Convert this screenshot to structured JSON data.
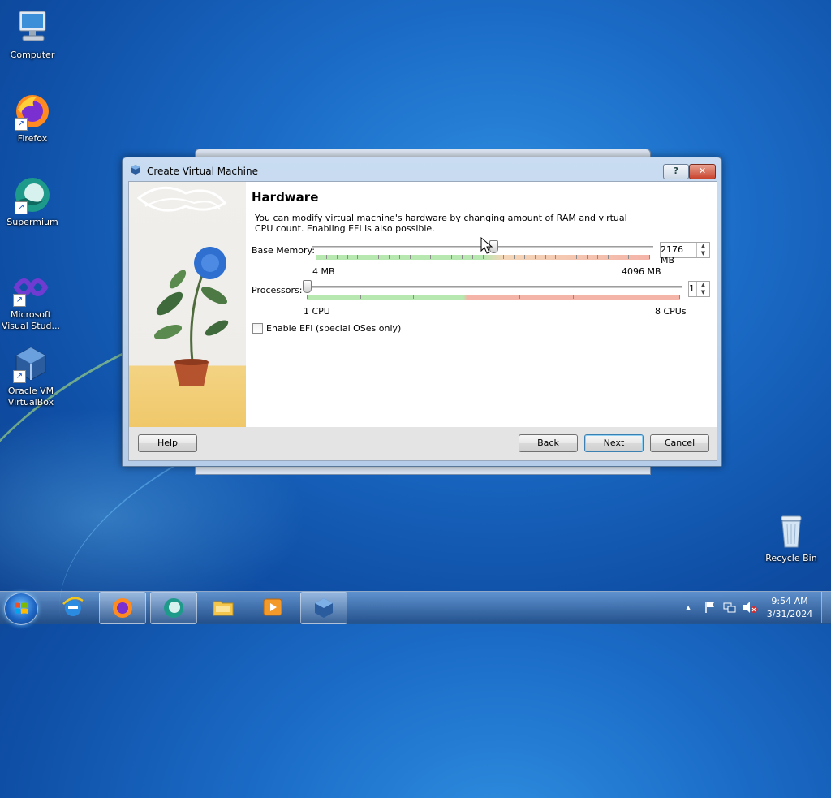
{
  "desktop": {
    "icons": [
      {
        "label": "Computer",
        "icon": "computer-icon"
      },
      {
        "label": "Firefox",
        "icon": "firefox-icon"
      },
      {
        "label": "Supermium",
        "icon": "supermium-icon"
      },
      {
        "label": "Microsoft Visual Stud...",
        "icon": "visual-studio-icon"
      },
      {
        "label": "Oracle VM VirtualBox",
        "icon": "virtualbox-icon"
      },
      {
        "label": "Recycle Bin",
        "icon": "recycle-bin-icon"
      }
    ]
  },
  "dialog": {
    "title": "Create Virtual Machine",
    "heading": "Hardware",
    "description": "You can modify virtual machine's hardware by changing amount of RAM and virtual CPU count. Enabling EFI is also possible.",
    "memory": {
      "label": "Base Memory:",
      "value_text": "2176 MB",
      "value": 2176,
      "min_label": "4 MB",
      "max_label": "4096 MB",
      "min": 4,
      "max": 4096
    },
    "processors": {
      "label": "Processors:",
      "value_text": "1",
      "value": 1,
      "min_label": "1 CPU",
      "max_label": "8 CPUs",
      "min": 1,
      "max": 8
    },
    "efi": {
      "label": "Enable EFI (special OSes only)",
      "checked": false
    },
    "buttons": {
      "help": "Help",
      "back": "Back",
      "next": "Next",
      "cancel": "Cancel"
    },
    "titlebar_help": "?",
    "titlebar_close": "✕"
  },
  "taskbar": {
    "items": [
      "start",
      "internet-explorer",
      "firefox",
      "supermium",
      "file-explorer",
      "media-player",
      "virtualbox"
    ],
    "time": "9:54 AM",
    "date": "3/31/2024",
    "tray_expand": "▲"
  },
  "colors": {
    "desktop": "#1b6cc7",
    "scale_green": "#b6e8b0",
    "scale_red": "#f4b4a8",
    "dialog_frame": "#c9dcf1"
  }
}
